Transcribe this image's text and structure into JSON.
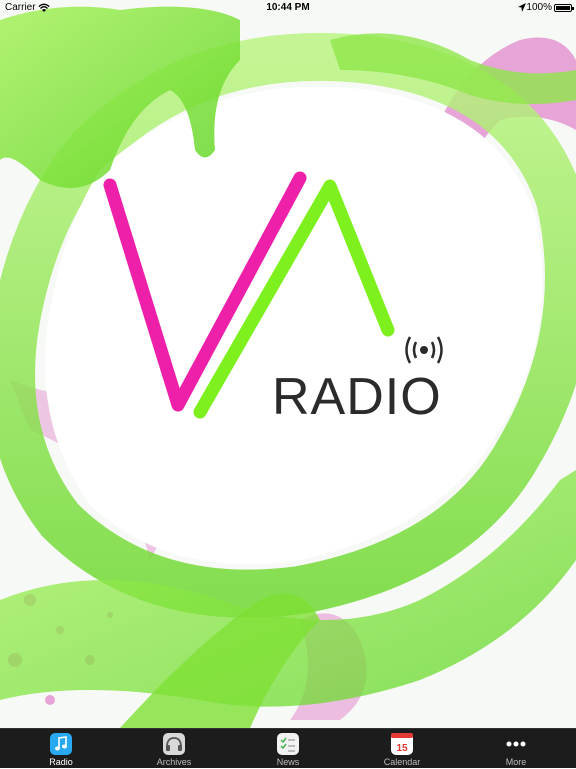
{
  "status_bar": {
    "carrier": "Carrier",
    "time": "10:44 PM",
    "battery": "100%"
  },
  "logo": {
    "text": "RADIO"
  },
  "colors": {
    "pink": "#ee1fa8",
    "green": "#7df01e",
    "tab_bg": "#1c1c1c"
  },
  "tab_bar": {
    "tabs": [
      {
        "label": "Radio",
        "icon": "music-note-icon",
        "active": true
      },
      {
        "label": "Archives",
        "icon": "headphones-icon"
      },
      {
        "label": "News",
        "icon": "checklist-icon"
      },
      {
        "label": "Calendar",
        "icon": "calendar-icon",
        "badge": "15"
      },
      {
        "label": "More",
        "icon": "more-dots-icon"
      }
    ]
  }
}
